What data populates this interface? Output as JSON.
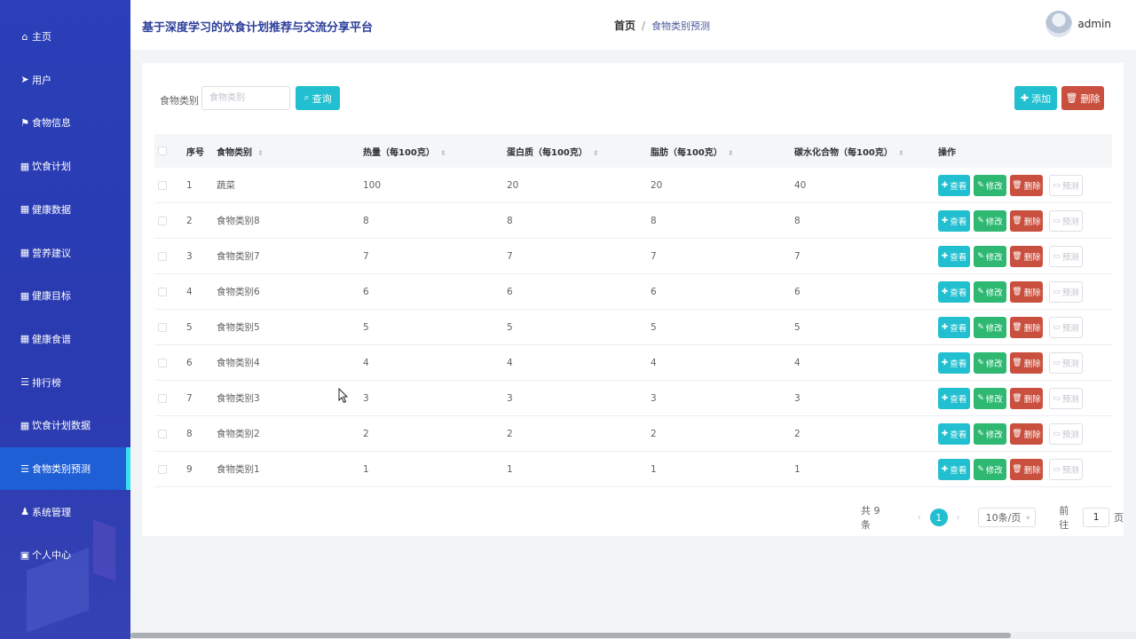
{
  "app": {
    "title": "基于深度学习的饮食计划推荐与交流分享平台"
  },
  "breadcrumb": {
    "home": "首页",
    "separator": "/",
    "current": "食物类别预测"
  },
  "user": {
    "name": "admin"
  },
  "sidebar": {
    "items": [
      {
        "label": "主页",
        "icon": "home-icon",
        "glyph": "⌂"
      },
      {
        "label": "用户",
        "icon": "send-icon",
        "glyph": "➤"
      },
      {
        "label": "食物信息",
        "icon": "flag-icon",
        "glyph": "⚑"
      },
      {
        "label": "饮食计划",
        "icon": "grid-icon",
        "glyph": "▦"
      },
      {
        "label": "健康数据",
        "icon": "grid-icon",
        "glyph": "▦"
      },
      {
        "label": "营养建议",
        "icon": "grid-icon",
        "glyph": "▦"
      },
      {
        "label": "健康目标",
        "icon": "grid-icon",
        "glyph": "▦"
      },
      {
        "label": "健康食谱",
        "icon": "grid-icon",
        "glyph": "▦"
      },
      {
        "label": "排行榜",
        "icon": "list-icon",
        "glyph": "☰"
      },
      {
        "label": "饮食计划数据",
        "icon": "grid-icon",
        "glyph": "▦"
      },
      {
        "label": "食物类别预测",
        "icon": "list-icon",
        "glyph": "☰",
        "active": true
      },
      {
        "label": "系统管理",
        "icon": "pin-icon",
        "glyph": "♟"
      },
      {
        "label": "个人中心",
        "icon": "window-icon",
        "glyph": "▣"
      }
    ]
  },
  "filter": {
    "label": "食物类别",
    "placeholder": "食物类别",
    "query_label": "查询"
  },
  "toolbar": {
    "add_label": "添加",
    "delete_label": "删除"
  },
  "table": {
    "columns": [
      "序号",
      "食物类别",
      "热量（每100克）",
      "蛋白质（每100克）",
      "脂肪（每100克）",
      "碳水化合物（每100克）",
      "操作"
    ],
    "rows": [
      [
        "1",
        "蔬菜",
        "100",
        "20",
        "20",
        "40"
      ],
      [
        "2",
        "食物类别8",
        "8",
        "8",
        "8",
        "8"
      ],
      [
        "3",
        "食物类别7",
        "7",
        "7",
        "7",
        "7"
      ],
      [
        "4",
        "食物类别6",
        "6",
        "6",
        "6",
        "6"
      ],
      [
        "5",
        "食物类别5",
        "5",
        "5",
        "5",
        "5"
      ],
      [
        "6",
        "食物类别4",
        "4",
        "4",
        "4",
        "4"
      ],
      [
        "7",
        "食物类别3",
        "3",
        "3",
        "3",
        "3"
      ],
      [
        "8",
        "食物类别2",
        "2",
        "2",
        "2",
        "2"
      ],
      [
        "9",
        "食物类别1",
        "1",
        "1",
        "1",
        "1"
      ]
    ],
    "actions": {
      "view": "查看",
      "edit": "修改",
      "delete": "删除",
      "predict": "预测"
    }
  },
  "pagination": {
    "total": "共 9 条",
    "current_page": "1",
    "page_size": "10条/页",
    "goto_prefix": "前往",
    "goto_value": "1",
    "goto_suffix": "页"
  },
  "colors": {
    "sidebar": "#2a3fb8",
    "active_item": "#1f5fd6",
    "primary": "#21bfcf",
    "success": "#2eb872",
    "danger": "#c9503f"
  }
}
